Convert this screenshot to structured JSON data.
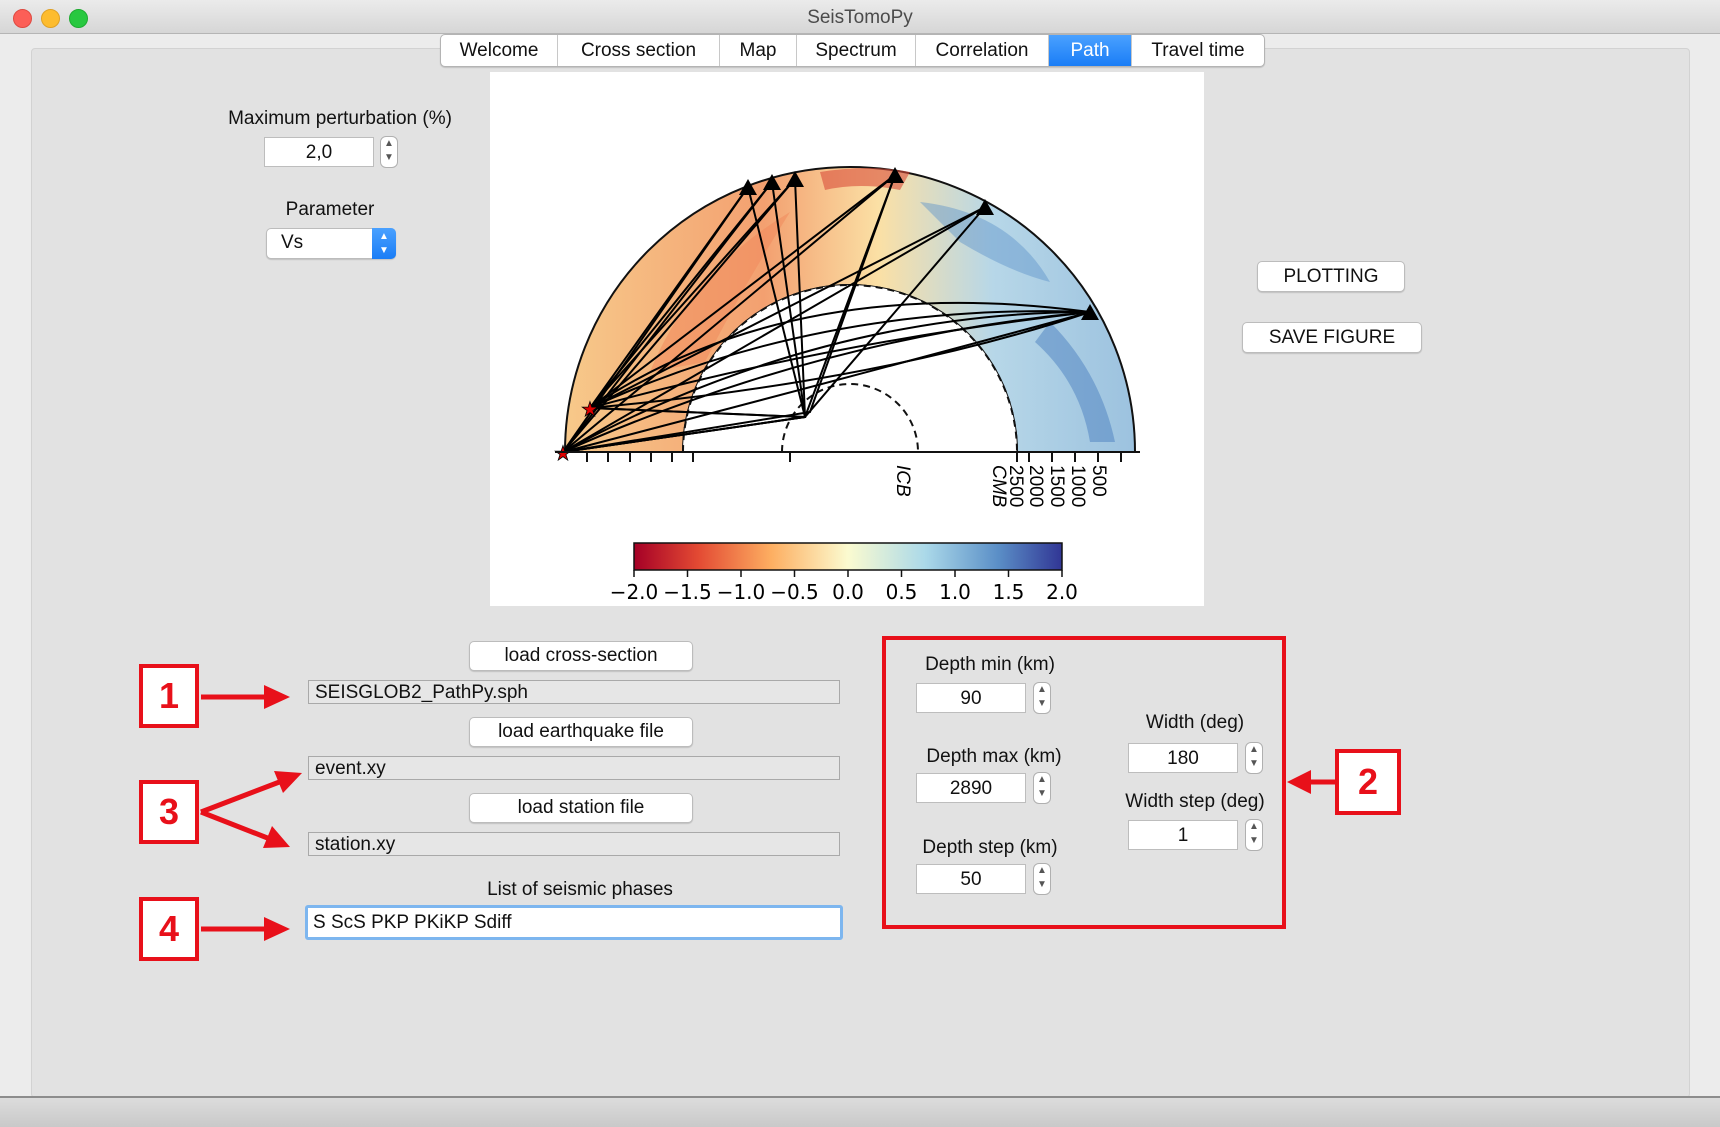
{
  "window": {
    "title": "SeisTomoPy"
  },
  "tabs": [
    {
      "label": "Welcome",
      "active": false
    },
    {
      "label": "Cross section",
      "active": false
    },
    {
      "label": "Map",
      "active": false
    },
    {
      "label": "Spectrum",
      "active": false
    },
    {
      "label": "Correlation",
      "active": false
    },
    {
      "label": "Path",
      "active": true
    },
    {
      "label": "Travel time",
      "active": false
    }
  ],
  "controls": {
    "max_perturbation_label": "Maximum perturbation (%)",
    "max_perturbation_value": "2,0",
    "parameter_label": "Parameter",
    "parameter_value": "Vs"
  },
  "actions": {
    "plotting": "PLOTTING",
    "save_figure": "SAVE FIGURE"
  },
  "files": {
    "load_cross_section": "load cross-section",
    "cross_section_file": "SEISGLOB2_PathPy.sph",
    "load_earthquake": "load earthquake file",
    "earthquake_file": "event.xy",
    "load_station": "load station file",
    "station_file": "station.xy",
    "phases_label": "List of seismic phases",
    "phases_value": "S ScS PKP PKiKP Sdiff"
  },
  "depth": {
    "min_label": "Depth min (km)",
    "min_value": "90",
    "max_label": "Depth max (km)",
    "max_value": "2890",
    "step_label": "Depth step (km)",
    "step_value": "50",
    "width_label": "Width (deg)",
    "width_value": "180",
    "width_step_label": "Width step (deg)",
    "width_step_value": "1"
  },
  "annotations": {
    "one": "1",
    "two": "2",
    "three": "3",
    "four": "4"
  },
  "figure": {
    "depth_labels": [
      "500",
      "1000",
      "1500",
      "2000",
      "2500"
    ],
    "cmb_label": "CMB",
    "icb_label": "ICB",
    "colorbar_ticks": [
      "−2.0",
      "−1.5",
      "−1.0",
      "−0.5",
      "0.0",
      "0.5",
      "1.0",
      "1.5",
      "2.0"
    ],
    "colors": {
      "neg": "#b2182b",
      "mid": "#f7f7c8",
      "pos": "#313695"
    }
  },
  "colors": {
    "accent": "#1a7df6",
    "annotation_red": "#e8101a"
  }
}
